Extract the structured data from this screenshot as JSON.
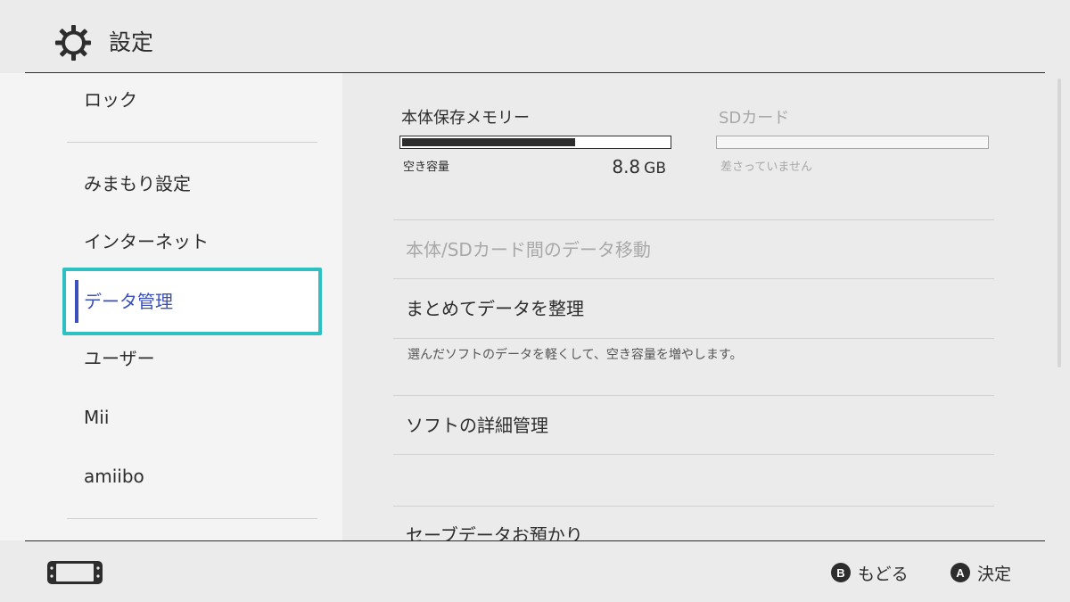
{
  "header": {
    "title": "設定",
    "icon": "gear-icon"
  },
  "sidebar": {
    "items": [
      {
        "label": "ロック"
      },
      {
        "label": "みまもり設定"
      },
      {
        "label": "インターネット"
      },
      {
        "label": "データ管理"
      },
      {
        "label": "ユーザー"
      },
      {
        "label": "Mii"
      },
      {
        "label": "amiibo"
      }
    ],
    "selected_index": 3
  },
  "storage": {
    "system": {
      "title": "本体保存メモリー",
      "free_label": "空き容量",
      "free_value": "8.8",
      "free_unit": "GB",
      "used_fraction": 0.65
    },
    "sd": {
      "title": "SDカード",
      "status": "差さっていません",
      "used_fraction": 0
    }
  },
  "menu": {
    "move_data": "本体/SDカード間のデータ移動",
    "organize": "まとめてデータを整理",
    "organize_desc": "選んだソフトのデータを軽くして、空き容量を増やします。",
    "software_detail": "ソフトの詳細管理",
    "save_cloud": "セーブデータお預かり"
  },
  "footer": {
    "back": {
      "button": "B",
      "label": "もどる"
    },
    "confirm": {
      "button": "A",
      "label": "決定"
    },
    "device_icon": "handheld-console-icon"
  },
  "colors": {
    "background": "#ebebeb",
    "sidebar_bg": "#f4f4f4",
    "selection_border": "#2fc1c1",
    "selection_text": "#3b4fbd",
    "disabled_text": "#a8a8a8"
  }
}
